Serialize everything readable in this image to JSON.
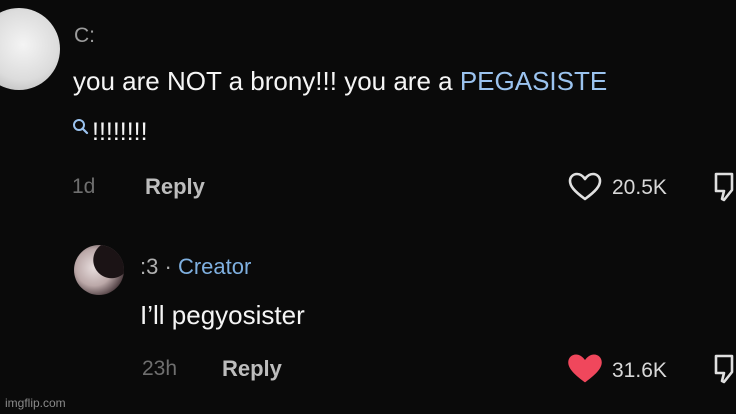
{
  "comments": [
    {
      "username": "C:",
      "text_line1_plain": "you are NOT a brony!!! you are a ",
      "text_line1_highlight": "PEGASISTE",
      "text_line2": "!!!!!!!!",
      "time": "1d",
      "reply_label": "Reply",
      "like_count": "20.5K",
      "liked": false
    },
    {
      "username": ":3",
      "separator": "·",
      "badge": "Creator",
      "text": "I’ll pegyosister",
      "time": "23h",
      "reply_label": "Reply",
      "like_count": "31.6K",
      "liked": true
    }
  ],
  "watermark": "imgflip.com",
  "colors": {
    "background": "#0a0a0a",
    "highlight": "#9bc3ef",
    "creator": "#7fb0e0",
    "liked_heart": "#f0475c"
  },
  "icons": [
    "search-icon",
    "heart-outline-icon",
    "heart-filled-icon",
    "dislike-icon"
  ]
}
